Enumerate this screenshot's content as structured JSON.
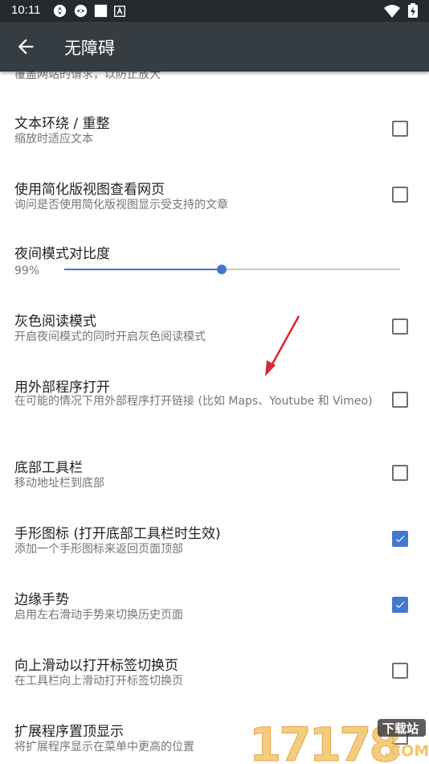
{
  "status_bar": {
    "time": "10:11",
    "notification_icons": [
      "cyclone-icon",
      "cyclone-icon",
      "square-icon",
      "sim-icon"
    ],
    "right_icons": [
      "wifi-icon",
      "battery-charging-icon"
    ]
  },
  "app_bar": {
    "back_icon": "arrow-back-icon",
    "title": "无障碍"
  },
  "cut_summary": "覆盖网站的请求，以防止放大",
  "preferences": [
    {
      "title": "文本环绕 / 重整",
      "summary": "缩放时适应文本",
      "checked": false
    },
    {
      "title": "使用简化版视图查看网页",
      "summary": "询问是否使用简化版视图显示受支持的文章",
      "checked": false
    },
    {
      "title": "夜间模式对比度",
      "value_label": "99%",
      "slider_fraction": 0.47
    },
    {
      "title": "灰色阅读模式",
      "summary": "开启夜间模式的同时开启灰色阅读模式",
      "checked": false
    },
    {
      "title": "用外部程序打开",
      "summary": "在可能的情况下用外部程序打开链接 (比如 Maps、Youtube 和 Vimeo)",
      "checked": false
    },
    {
      "title": "底部工具栏",
      "summary": "移动地址栏到底部",
      "checked": false
    },
    {
      "title": "手形图标 (打开底部工具栏时生效)",
      "summary": "添加一个手形图标来返回页面顶部",
      "checked": true
    },
    {
      "title": "边缘手势",
      "summary": "启用左右滑动手势来切换历史页面",
      "checked": true
    },
    {
      "title": "向上滑动以打开标签切换页",
      "summary": "在工具栏向上滑动打开标签切换页",
      "checked": false
    },
    {
      "title": "扩展程序置顶显示",
      "summary": "将扩展程序显示在菜单中更高的位置",
      "checked": false
    }
  ],
  "colors": {
    "accent": "#4677cf",
    "app_bar": "#353c42",
    "status_bar": "#242a2e",
    "annotation_arrow": "#d9262a"
  },
  "watermark": {
    "number": "17178",
    "label": "下载站",
    "domain": ".COM"
  }
}
